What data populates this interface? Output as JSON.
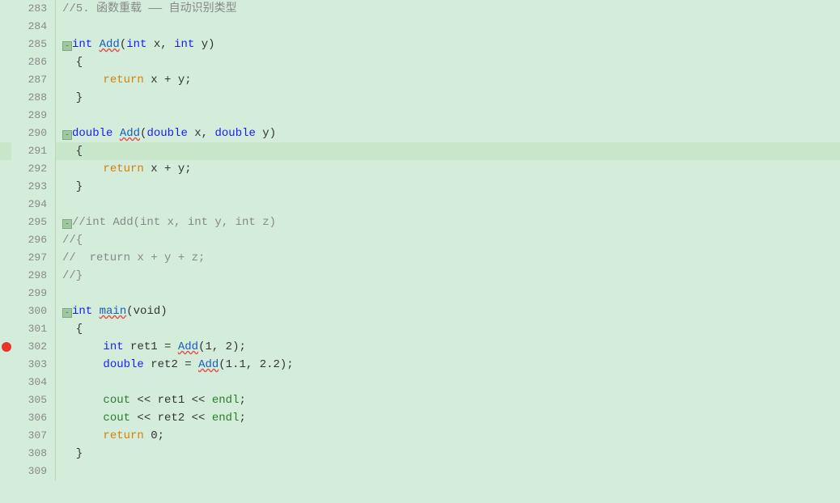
{
  "editor": {
    "background": "#d4edda",
    "lines": [
      {
        "num": "283",
        "content": "//5. 函数重载 —— 自动识别类型",
        "type": "comment",
        "highlight": false
      },
      {
        "num": "284",
        "content": "",
        "type": "empty",
        "highlight": false
      },
      {
        "num": "285",
        "content": "int Add(int x, int y)",
        "type": "func_def_int",
        "highlight": false,
        "fold": true
      },
      {
        "num": "286",
        "content": "  {",
        "type": "brace",
        "highlight": false
      },
      {
        "num": "287",
        "content": "      return x + y;",
        "type": "return_stmt",
        "highlight": false
      },
      {
        "num": "288",
        "content": "  }",
        "type": "brace",
        "highlight": false
      },
      {
        "num": "289",
        "content": "",
        "type": "empty",
        "highlight": false
      },
      {
        "num": "290",
        "content": "double Add(double x, double y)",
        "type": "func_def_double",
        "highlight": false,
        "fold": true
      },
      {
        "num": "291",
        "content": "  {",
        "type": "brace",
        "highlight": true
      },
      {
        "num": "292",
        "content": "      return x + y;",
        "type": "return_stmt",
        "highlight": false
      },
      {
        "num": "293",
        "content": "  }",
        "type": "brace",
        "highlight": false
      },
      {
        "num": "294",
        "content": "",
        "type": "empty",
        "highlight": false
      },
      {
        "num": "295",
        "content": "//int Add(int x, int y, int z)",
        "type": "comment_fold",
        "highlight": false,
        "fold": true
      },
      {
        "num": "296",
        "content": "//{",
        "type": "comment",
        "highlight": false
      },
      {
        "num": "297",
        "content": "//  return x + y + z;",
        "type": "comment",
        "highlight": false
      },
      {
        "num": "298",
        "content": "//}",
        "type": "comment",
        "highlight": false
      },
      {
        "num": "299",
        "content": "",
        "type": "empty",
        "highlight": false
      },
      {
        "num": "300",
        "content": "int main(void)",
        "type": "func_main",
        "highlight": false,
        "fold": true
      },
      {
        "num": "301",
        "content": "  {",
        "type": "brace",
        "highlight": false
      },
      {
        "num": "302",
        "content": "      int ret1 = Add(1, 2);",
        "type": "stmt",
        "highlight": false,
        "breakpoint": true
      },
      {
        "num": "303",
        "content": "      double ret2 = Add(1.1, 2.2);",
        "type": "stmt",
        "highlight": false
      },
      {
        "num": "304",
        "content": "",
        "type": "empty",
        "highlight": false
      },
      {
        "num": "305",
        "content": "      cout << ret1 << endl;",
        "type": "stmt",
        "highlight": false
      },
      {
        "num": "306",
        "content": "      cout << ret2 << endl;",
        "type": "stmt",
        "highlight": false
      },
      {
        "num": "307",
        "content": "      return 0;",
        "type": "return_stmt",
        "highlight": false
      },
      {
        "num": "308",
        "content": "  }",
        "type": "brace",
        "highlight": false
      },
      {
        "num": "309",
        "content": "",
        "type": "empty",
        "highlight": false
      }
    ]
  }
}
